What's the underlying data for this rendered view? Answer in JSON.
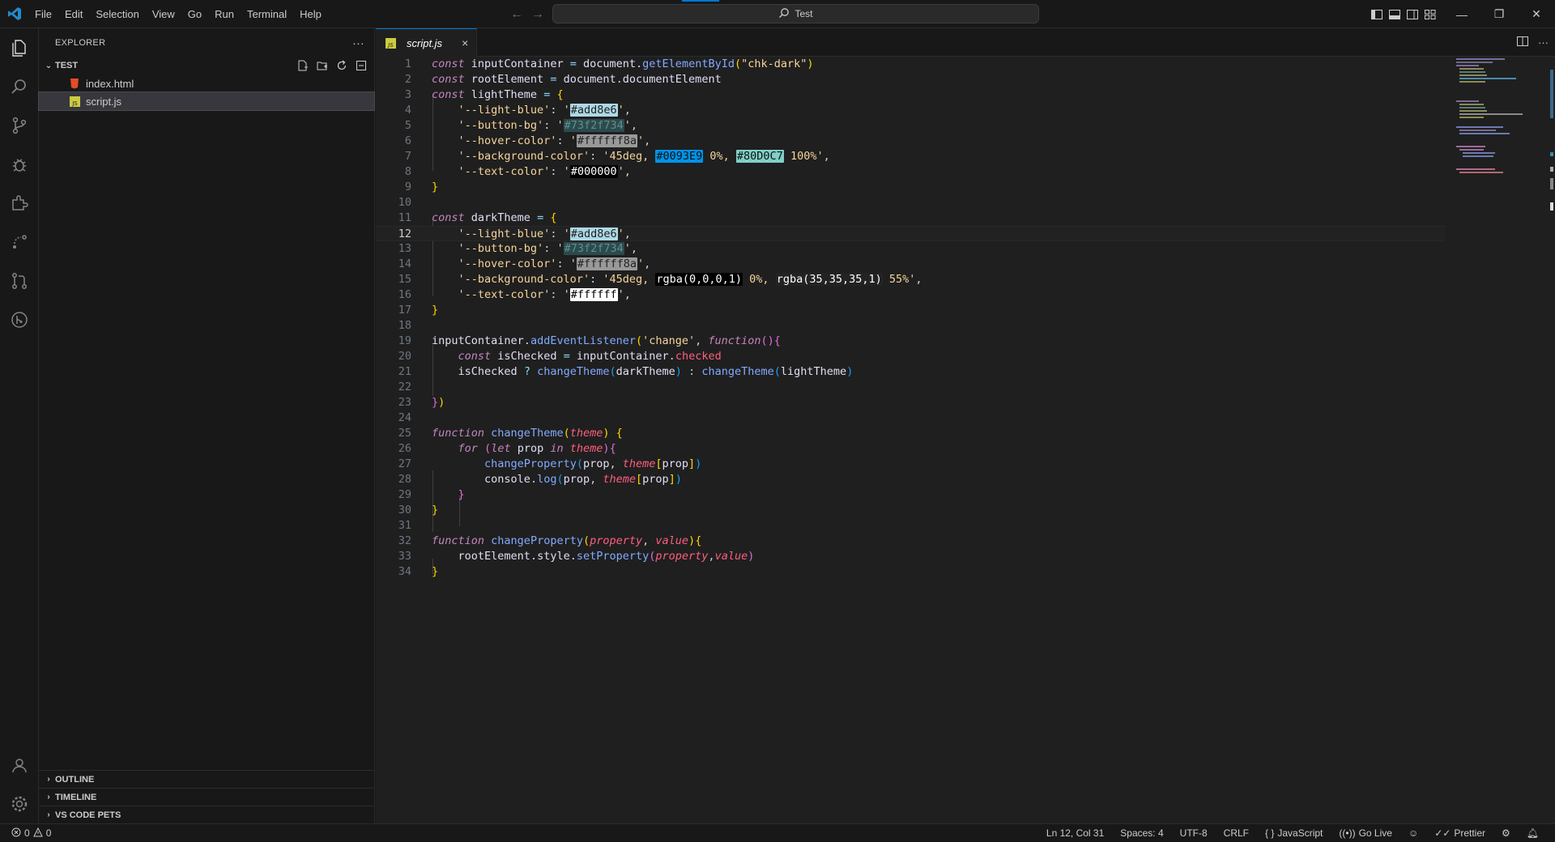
{
  "title_bar": {
    "menu": [
      "File",
      "Edit",
      "Selection",
      "View",
      "Go",
      "Run",
      "Terminal",
      "Help"
    ],
    "search_text": "Test",
    "colors": {
      "accent": "#0078d4",
      "logo": "#2489ca"
    }
  },
  "activity_bar": {
    "icons": [
      "explorer-icon",
      "search-icon",
      "source-control-icon",
      "run-debug-icon",
      "extensions-icon",
      "live-share-icon",
      "pull-requests-icon",
      "git-graph-icon",
      "accounts-icon",
      "manage-gear-icon"
    ]
  },
  "sidebar": {
    "title": "EXPLORER",
    "more": "···",
    "folder": "TEST",
    "files": [
      {
        "name": "index.html",
        "icon": "html-file-icon",
        "selected": false
      },
      {
        "name": "script.js",
        "icon": "js-file-icon",
        "selected": true
      }
    ],
    "bottom_sections": [
      "OUTLINE",
      "TIMELINE",
      "VS CODE PETS"
    ]
  },
  "editor": {
    "tab": {
      "label": "script.js",
      "close": "×"
    },
    "active_line": 12,
    "lines": [
      "1",
      "2",
      "3",
      "4",
      "5",
      "6",
      "7",
      "8",
      "9",
      "10",
      "11",
      "12",
      "13",
      "14",
      "15",
      "16",
      "17",
      "18",
      "19",
      "20",
      "21",
      "22",
      "23",
      "24",
      "25",
      "26",
      "27",
      "28",
      "29",
      "30",
      "31",
      "32",
      "33",
      "34"
    ]
  },
  "status_bar": {
    "problems_errors": "0",
    "problems_warnings": "0",
    "position": "Ln 12, Col 31",
    "spaces": "Spaces: 4",
    "encoding": "UTF-8",
    "eol": "CRLF",
    "language": "JavaScript",
    "golive": "Go Live",
    "prettier": "Prettier"
  }
}
